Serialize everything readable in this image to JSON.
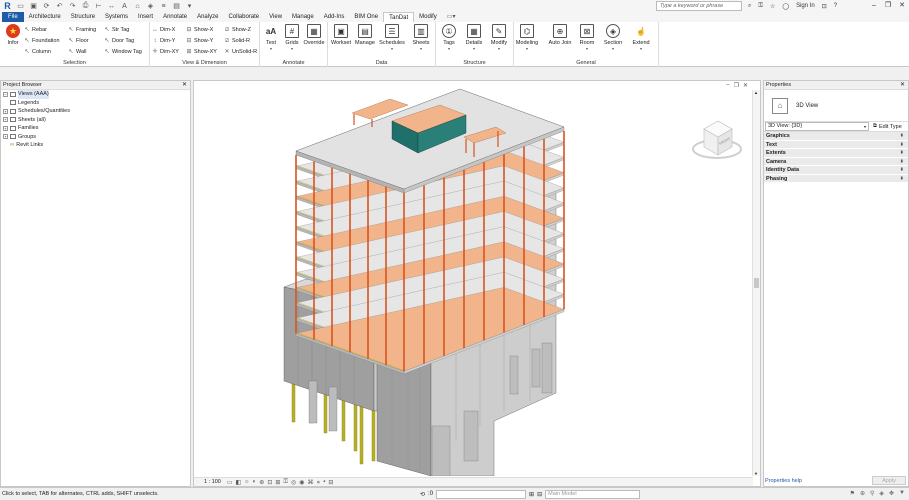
{
  "titlebar": {
    "search_placeholder": "Type a keyword or phrase",
    "sign_in": "Sign In"
  },
  "tabs": [
    "File",
    "Architecture",
    "Structure",
    "Systems",
    "Insert",
    "Annotate",
    "Analyze",
    "Collaborate",
    "View",
    "Manage",
    "Add-Ins",
    "BIM One",
    "TanDat",
    "Modify"
  ],
  "active_tab": "TanDat",
  "ribbon": {
    "selection": {
      "title": "Selection",
      "infor": "Infor",
      "items": [
        "Rebar",
        "Foundation",
        "Column",
        "Framing",
        "Floor",
        "Wall",
        "Str Tag",
        "Door Tag",
        "Window Tag"
      ]
    },
    "view_dimension": {
      "title": "View & Dimension",
      "items": [
        "Dim-X",
        "Dim-Y",
        "Dim-XY",
        "Show-X",
        "Show-Y",
        "Show-XY",
        "Show-Z",
        "Solid-R",
        "UnSolid-R"
      ]
    },
    "annotate": {
      "title": "Annotate",
      "items": [
        "Text",
        "Grids",
        "Override"
      ]
    },
    "data": {
      "title": "Data",
      "items": [
        "Workset",
        "Manage",
        "Schedules",
        "Sheets"
      ]
    },
    "structure": {
      "title": "Structure",
      "items": [
        "Tags",
        "Details",
        "Modify"
      ]
    },
    "general": {
      "title": "General",
      "items": [
        "Modeling",
        "Auto Join",
        "Room",
        "Section",
        "Extend"
      ]
    }
  },
  "project_browser": {
    "title": "Project Browser",
    "items": [
      {
        "label": "Views (AAA)",
        "selected": true
      },
      {
        "label": "Legends"
      },
      {
        "label": "Schedules/Quantities"
      },
      {
        "label": "Sheets (all)"
      },
      {
        "label": "Families"
      },
      {
        "label": "Groups"
      },
      {
        "label": "Revit Links"
      }
    ]
  },
  "viewport": {
    "scale": "1 : 100",
    "viewcube_label": "FRONT"
  },
  "properties": {
    "title": "Properties",
    "type_name": "3D View",
    "instance": "3D View: {3D}",
    "edit_type": "Edit Type",
    "categories": [
      "Graphics",
      "Text",
      "Extents",
      "Camera",
      "Identity Data",
      "Phasing"
    ],
    "help": "Properties help",
    "apply": "Apply"
  },
  "status": {
    "message": "Click to select, TAB for alternates, CTRL adds, SHIFT unselects.",
    "zero": ":0",
    "model": "Main Model"
  },
  "colors": {
    "brand": "#1e5ba8",
    "column": "#d9531e",
    "slab": "#f1b48b",
    "concrete": "#a8a8a8",
    "pile": "#b8b024",
    "glass": "#1f6f6a"
  }
}
